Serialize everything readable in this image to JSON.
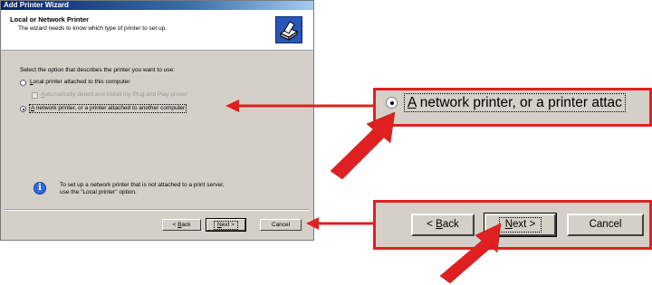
{
  "window": {
    "title": "Add Printer Wizard"
  },
  "header": {
    "title": "Local or Network Printer",
    "subtitle": "The wizard needs to know which type of printer to set up.",
    "icon": "printer-icon"
  },
  "body": {
    "prompt": "Select the option that describes the printer you want to use:",
    "options": [
      {
        "label_pre": "",
        "label_u": "L",
        "label_post": "ocal printer attached to this computer",
        "selected": false
      },
      {
        "label_pre": "",
        "label_u": "A",
        "label_post": " network printer, or a printer attached to another computer",
        "selected": true
      }
    ],
    "checkbox": {
      "label_pre": "",
      "label_u": "A",
      "label_post": "utomatically detect and install my Plug and Play printer",
      "checked": false,
      "disabled": true
    },
    "info_line1": "To set up a network printer that is not attached to a print server,",
    "info_line2": "use the \"Local printer\" option."
  },
  "buttons": {
    "back_pre": "< ",
    "back_u": "B",
    "back_post": "ack",
    "next_u": "N",
    "next_post": "ext >",
    "cancel": "Cancel"
  },
  "zoom_top": {
    "label_u": "A",
    "label_post": " network printer, or a printer attac"
  },
  "zoom_bottom": {
    "back_pre": "< ",
    "back_u": "B",
    "back_post": "ack",
    "next_u": "N",
    "next_post": "ext >",
    "cancel": "Cancel"
  },
  "colors": {
    "annotation": "#e02020",
    "title_bar": "#0a246a",
    "dialog_face": "#d4d0c8"
  }
}
